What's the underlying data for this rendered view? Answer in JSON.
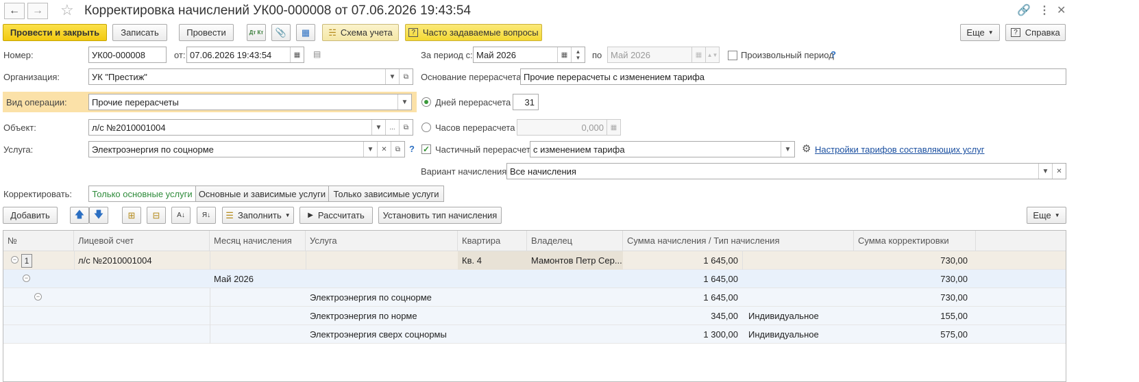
{
  "window": {
    "title": "Корректировка начислений УК00-000008 от 07.06.2026 19:43:54",
    "back_icon": "arrow-left-icon",
    "forward_icon": "arrow-right-icon"
  },
  "toolbar": {
    "post_close": "Провести и закрыть",
    "save": "Записать",
    "post": "Провести",
    "scheme": "Схема учета",
    "faq": "Часто задаваемые вопросы",
    "more": "Еще",
    "help": "Справка",
    "dtkt_icon": "Дт Кт"
  },
  "form": {
    "number_label": "Номер:",
    "number_value": "УК00-000008",
    "date_label": "от:",
    "date_value": "07.06.2026 19:43:54",
    "period_label": "За период с:",
    "period_from": "Май 2026",
    "period_to_label": "по",
    "period_to": "Май 2026",
    "arbitrary_period": "Произвольный период",
    "help_q": "?",
    "org_label": "Организация:",
    "org_value": "УК \"Престиж\"",
    "reason_label": "Основание перерасчета:",
    "reason_value": "Прочие перерасчеты с изменением тарифа",
    "op_label": "Вид операции:",
    "op_value": "Прочие перерасчеты",
    "days_label": "Дней перерасчета",
    "days_value": "31",
    "object_label": "Объект:",
    "object_value": "л/с №2010001004",
    "hours_label": "Часов перерасчета",
    "hours_value": "0,000",
    "service_label": "Услуга:",
    "service_value": "Электроэнергия по соцнорме",
    "partial_label": "Частичный перерасчет",
    "partial_value": "с изменением тарифа",
    "tariff_link": "Настройки тарифов составляющих услуг",
    "variant_label": "Вариант начисления:",
    "variant_value": "Все начисления",
    "correct_label": "Корректировать:",
    "segments": [
      "Только основные услуги",
      "Основные и зависимые услуги",
      "Только зависимые услуги"
    ]
  },
  "table_toolbar": {
    "add": "Добавить",
    "fill": "Заполнить",
    "calculate": "Рассчитать",
    "set_type": "Установить тип начисления",
    "more": "Еще"
  },
  "table": {
    "headers": [
      "№",
      "Лицевой счет",
      "Месяц начисления",
      "Услуга",
      "Квартира",
      "Владелец",
      "Сумма начисления / Тип начисления",
      "Сумма корректировки"
    ],
    "rows": [
      {
        "num": "1",
        "account": "л/с №2010001004",
        "month": "",
        "service": "",
        "flat": "Кв. 4",
        "owner": "Мамонтов Петр Сер...",
        "sum": "1 645,00",
        "type": "",
        "corr": "730,00"
      },
      {
        "num": "",
        "account": "",
        "month": "Май 2026",
        "service": "",
        "flat": "",
        "owner": "",
        "sum": "1 645,00",
        "type": "",
        "corr": "730,00"
      },
      {
        "num": "",
        "account": "",
        "month": "",
        "service": "Электроэнергия по соцнорме",
        "flat": "",
        "owner": "",
        "sum": "1 645,00",
        "type": "",
        "corr": "730,00"
      },
      {
        "num": "",
        "account": "",
        "month": "",
        "service": "Электроэнергия по норме",
        "flat": "",
        "owner": "",
        "sum": "345,00",
        "type": "Индивидуальное",
        "corr": "155,00"
      },
      {
        "num": "",
        "account": "",
        "month": "",
        "service": "Электроэнергия сверх соцнормы",
        "flat": "",
        "owner": "",
        "sum": "1 300,00",
        "type": "Индивидуальное",
        "corr": "575,00"
      }
    ]
  }
}
